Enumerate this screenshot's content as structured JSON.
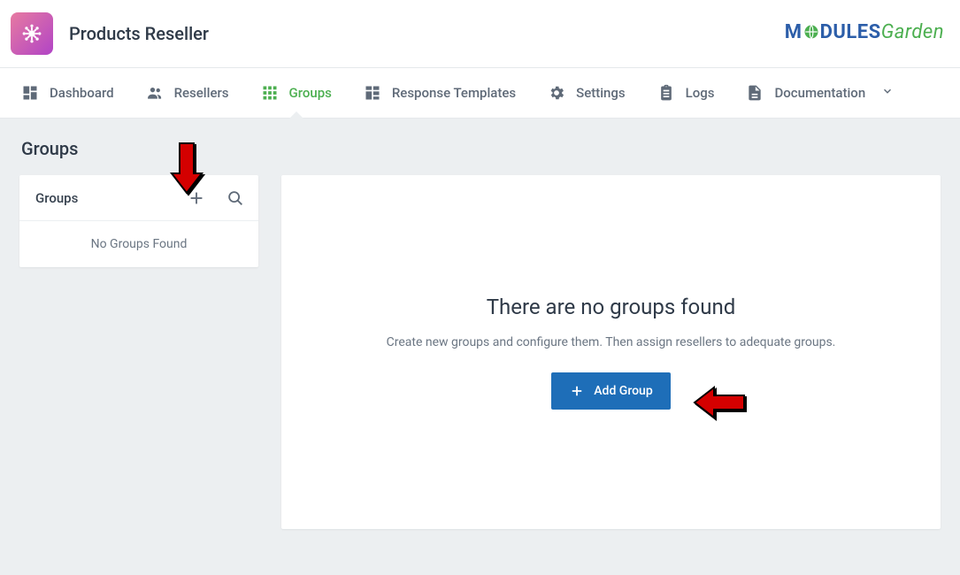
{
  "header": {
    "title": "Products Reseller"
  },
  "nav": {
    "items": [
      {
        "label": "Dashboard"
      },
      {
        "label": "Resellers"
      },
      {
        "label": "Groups",
        "active": true
      },
      {
        "label": "Response Templates"
      },
      {
        "label": "Settings"
      },
      {
        "label": "Logs"
      },
      {
        "label": "Documentation",
        "has_dropdown": true
      }
    ]
  },
  "page": {
    "title": "Groups"
  },
  "sidebar": {
    "title": "Groups",
    "empty_label": "No Groups Found"
  },
  "main": {
    "empty_title": "There are no groups found",
    "empty_sub": "Create new groups and configure them. Then assign resellers to adequate groups.",
    "add_button": "Add Group"
  },
  "brand": {
    "part1": "M",
    "part2": "DULES",
    "part3": "Garden"
  }
}
